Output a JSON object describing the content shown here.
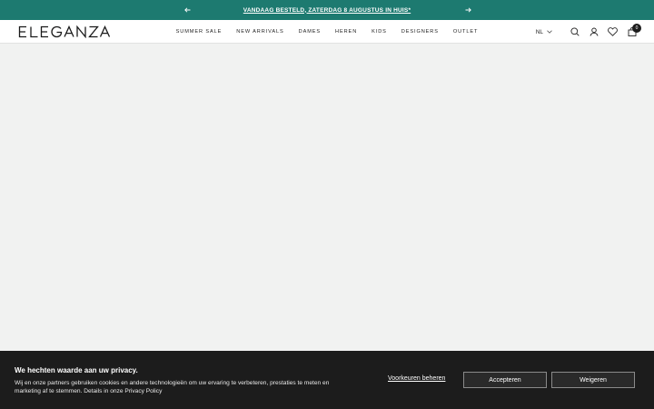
{
  "announcement": {
    "message": "VANDAAG BESTELD, ZATERDAG 8 AUGUSTUS IN HUIS*",
    "prev_icon": "arrow-left-icon",
    "next_icon": "arrow-right-icon"
  },
  "header": {
    "logo_text": "ELEGANZA",
    "nav": [
      {
        "label": "SUMMER SALE"
      },
      {
        "label": "NEW ARRIVALS"
      },
      {
        "label": "DAMES"
      },
      {
        "label": "HEREN"
      },
      {
        "label": "KIDS"
      },
      {
        "label": "DESIGNERS"
      },
      {
        "label": "OUTLET"
      }
    ],
    "language": "NL",
    "cart_count": "0",
    "icons": [
      "search-icon",
      "account-icon",
      "wishlist-icon",
      "cart-icon",
      "chevron-down-icon"
    ]
  },
  "cookie_banner": {
    "title": "We hechten waarde aan uw privacy.",
    "text": "Wij en onze partners gebruiken cookies en andere technologieën om uw ervaring te verbeteren, prestaties te meten en marketing af te stemmen.",
    "details_link": "Details in onze Privacy Policy",
    "preferences_label": "Voorkeuren beheren",
    "accept_label": "Accepteren",
    "reject_label": "Weigeren"
  },
  "colors": {
    "announcement_bg": "#1d7a70",
    "page_bg": "#f1f2f1",
    "cookie_bg": "#1c1c1c"
  }
}
